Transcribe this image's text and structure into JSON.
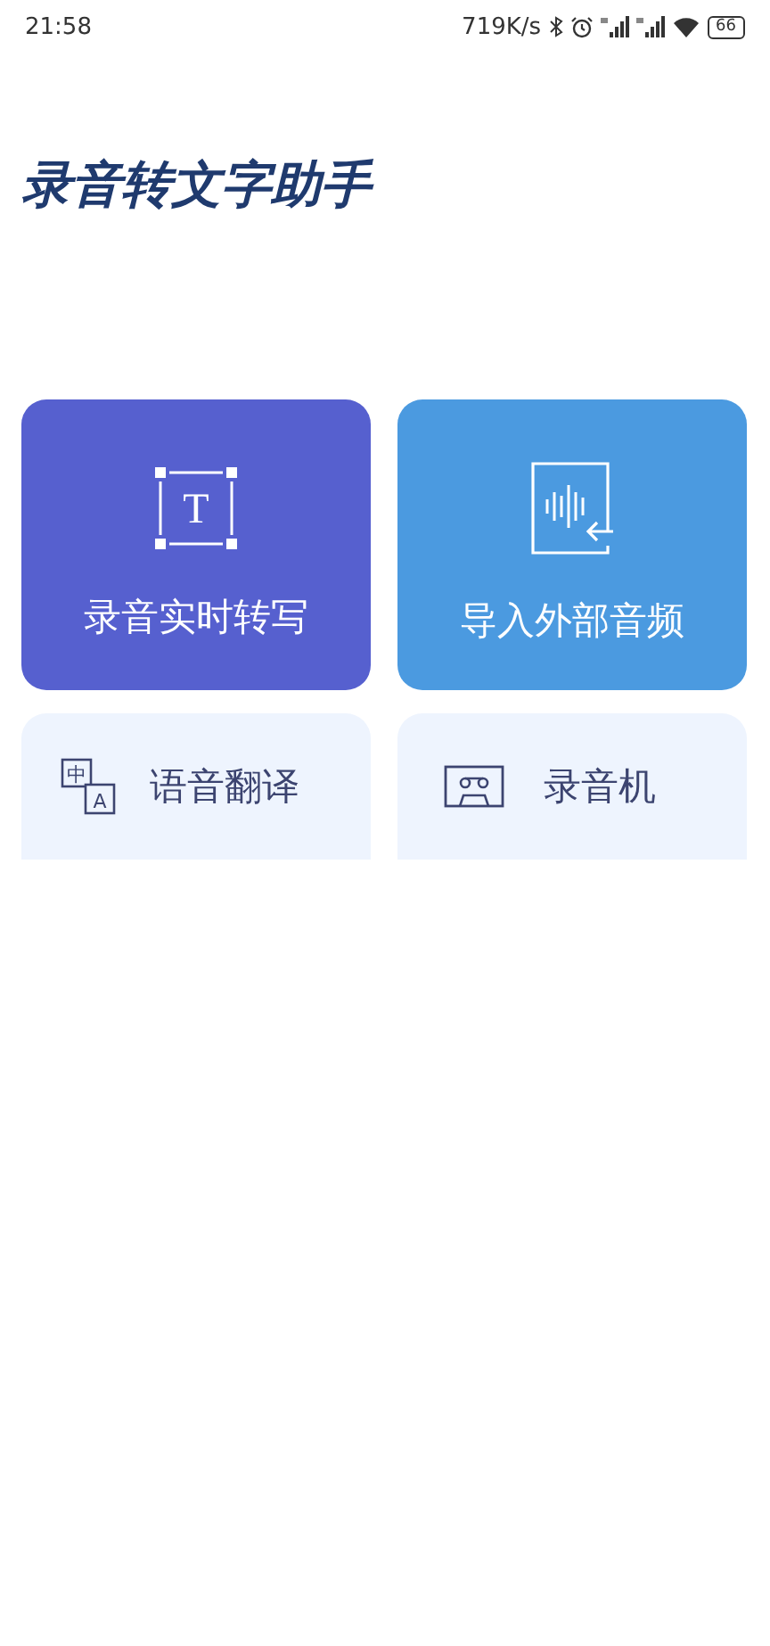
{
  "status_bar": {
    "time": "21:58",
    "speed": "719K/s",
    "battery": "66"
  },
  "title": "录音转文字助手",
  "features": [
    {
      "kind": "transcribe",
      "label": "录音实时转写",
      "glyph": "T",
      "color": "#5660cf"
    },
    {
      "kind": "import",
      "label": "导入外部音频",
      "color": "#4b9ae0"
    },
    {
      "kind": "translate",
      "label": "语音翻译",
      "glyph": "中",
      "glyph2": "A"
    },
    {
      "kind": "recorder",
      "label": "录音机"
    }
  ]
}
